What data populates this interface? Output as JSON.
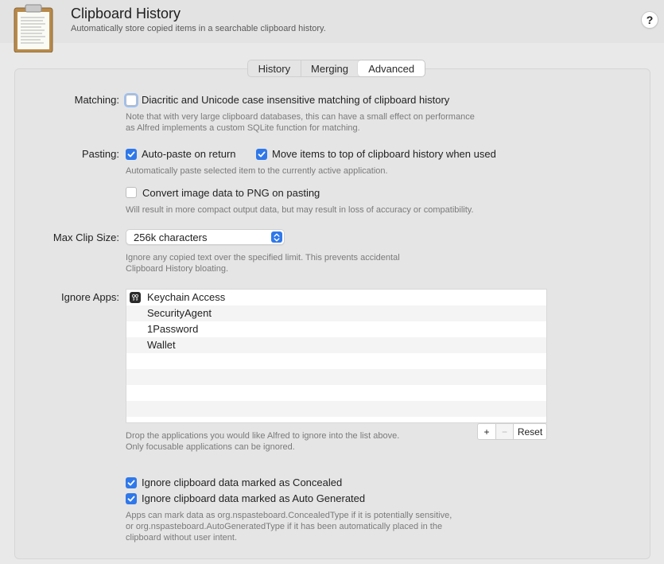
{
  "header": {
    "title": "Clipboard History",
    "subtitle": "Automatically store copied items in a searchable clipboard history.",
    "help": "?"
  },
  "tabs": [
    {
      "label": "History",
      "selected": false
    },
    {
      "label": "Merging",
      "selected": false
    },
    {
      "label": "Advanced",
      "selected": true
    }
  ],
  "matching": {
    "label": "Matching:",
    "checkbox_label": "Diacritic and Unicode case insensitive matching of clipboard history",
    "checked": false,
    "note_1": "Note that with very large clipboard databases, this can have a small effect on performance",
    "note_2": "as Alfred implements a custom SQLite function for matching."
  },
  "pasting": {
    "label": "Pasting:",
    "auto_paste_label": "Auto-paste on return",
    "auto_paste_checked": true,
    "move_items_label": "Move items to top of clipboard history when used",
    "move_items_checked": true,
    "note": "Automatically paste selected item to the currently active application.",
    "convert_label": "Convert image data to PNG on pasting",
    "convert_checked": false,
    "convert_note": "Will result in more compact output data, but may result in loss of accuracy or compatibility."
  },
  "max_clip": {
    "label": "Max Clip Size:",
    "value": "256k characters",
    "note_1": "Ignore any copied text over the specified limit. This prevents accidental",
    "note_2": "Clipboard History bloating."
  },
  "ignore_apps": {
    "label": "Ignore Apps:",
    "apps": [
      "Keychain Access",
      "SecurityAgent",
      "1Password",
      "Wallet"
    ],
    "add": "+",
    "remove": "−",
    "reset": "Reset",
    "note_1": "Drop the applications you would like Alfred to ignore into the list above.",
    "note_2": "Only focusable applications can be ignored."
  },
  "ignore_data": {
    "concealed_label": "Ignore clipboard data marked as Concealed",
    "concealed_checked": true,
    "auto_generated_label": "Ignore clipboard data marked as Auto Generated",
    "auto_generated_checked": true,
    "note_1": "Apps can mark data as org.nspasteboard.ConcealedType if it is potentially sensitive,",
    "note_2": "or org.nspasteboard.AutoGeneratedType if it has been automatically placed in the",
    "note_3": "clipboard without user intent."
  },
  "colors": {
    "accent": "#2f78ea",
    "background": "#e9e9e9",
    "header": "#e3e3e3"
  },
  "icons": {
    "app": "clipboard-icon",
    "keychain": "keychain-icon",
    "select": "updown-chevron-icon",
    "check": "checkmark-icon"
  }
}
